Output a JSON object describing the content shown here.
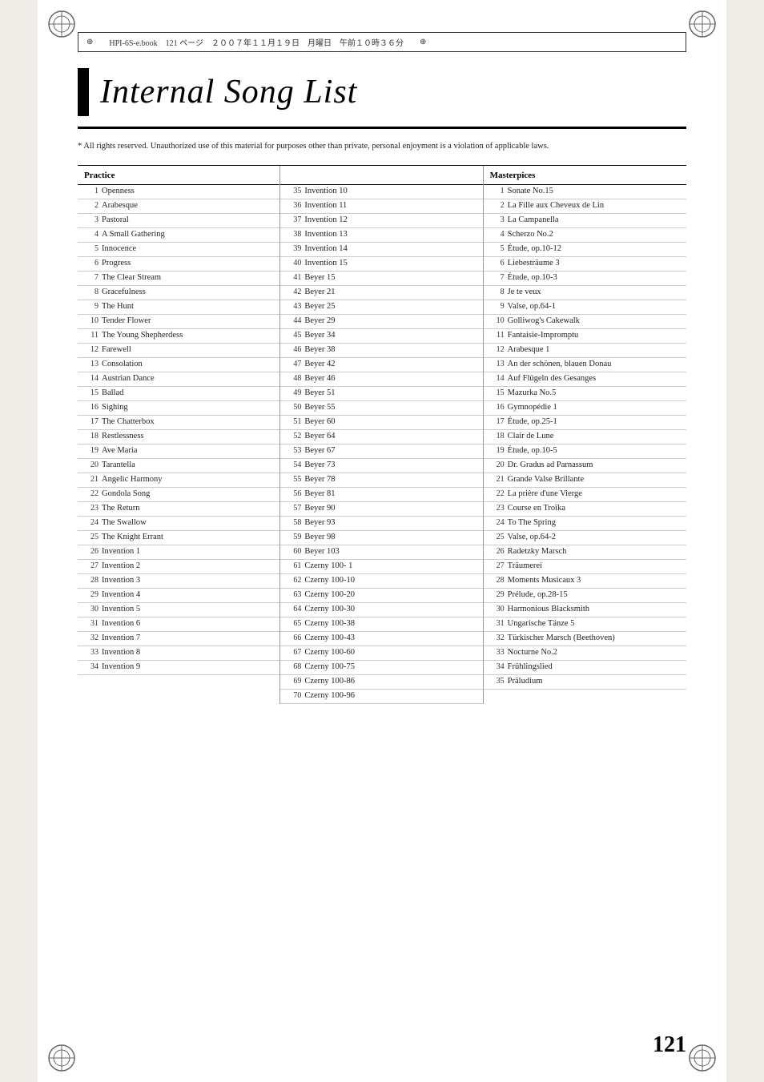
{
  "page": {
    "title": "Internal Song List",
    "page_number": "121",
    "header_text": "HPI-6S-e.book　121 ページ　２００７年１１月１９日　月曜日　午前１０時３６分",
    "copyright": "*   All rights reserved. Unauthorized use of this material for purposes other than private, personal enjoyment is a violation of applicable laws."
  },
  "columns": [
    {
      "header": "Practice",
      "songs": [
        {
          "num": "1",
          "name": "Openness"
        },
        {
          "num": "2",
          "name": "Arabesque"
        },
        {
          "num": "3",
          "name": "Pastoral"
        },
        {
          "num": "4",
          "name": "A Small Gathering"
        },
        {
          "num": "5",
          "name": "Innocence"
        },
        {
          "num": "6",
          "name": "Progress"
        },
        {
          "num": "7",
          "name": "The Clear Stream"
        },
        {
          "num": "8",
          "name": "Gracefulness"
        },
        {
          "num": "9",
          "name": "The Hunt"
        },
        {
          "num": "10",
          "name": "Tender Flower"
        },
        {
          "num": "11",
          "name": "The Young Shepherdess"
        },
        {
          "num": "12",
          "name": "Farewell"
        },
        {
          "num": "13",
          "name": "Consolation"
        },
        {
          "num": "14",
          "name": "Austrian Dance"
        },
        {
          "num": "15",
          "name": "Ballad"
        },
        {
          "num": "16",
          "name": "Sighing"
        },
        {
          "num": "17",
          "name": "The Chatterbox"
        },
        {
          "num": "18",
          "name": "Restlessness"
        },
        {
          "num": "19",
          "name": "Ave Maria"
        },
        {
          "num": "20",
          "name": "Tarantella"
        },
        {
          "num": "21",
          "name": "Angelic Harmony"
        },
        {
          "num": "22",
          "name": "Gondola Song"
        },
        {
          "num": "23",
          "name": "The Return"
        },
        {
          "num": "24",
          "name": "The Swallow"
        },
        {
          "num": "25",
          "name": "The Knight Errant"
        },
        {
          "num": "26",
          "name": "Invention 1"
        },
        {
          "num": "27",
          "name": "Invention 2"
        },
        {
          "num": "28",
          "name": "Invention 3"
        },
        {
          "num": "29",
          "name": "Invention 4"
        },
        {
          "num": "30",
          "name": "Invention 5"
        },
        {
          "num": "31",
          "name": "Invention 6"
        },
        {
          "num": "32",
          "name": "Invention 7"
        },
        {
          "num": "33",
          "name": "Invention 8"
        },
        {
          "num": "34",
          "name": "Invention 9"
        }
      ]
    },
    {
      "header": "",
      "songs": [
        {
          "num": "35",
          "name": "Invention 10"
        },
        {
          "num": "36",
          "name": "Invention 11"
        },
        {
          "num": "37",
          "name": "Invention 12"
        },
        {
          "num": "38",
          "name": "Invention 13"
        },
        {
          "num": "39",
          "name": "Invention 14"
        },
        {
          "num": "40",
          "name": "Invention 15"
        },
        {
          "num": "41",
          "name": "Beyer 15"
        },
        {
          "num": "42",
          "name": "Beyer 21"
        },
        {
          "num": "43",
          "name": "Beyer 25"
        },
        {
          "num": "44",
          "name": "Beyer 29"
        },
        {
          "num": "45",
          "name": "Beyer 34"
        },
        {
          "num": "46",
          "name": "Beyer 38"
        },
        {
          "num": "47",
          "name": "Beyer 42"
        },
        {
          "num": "48",
          "name": "Beyer 46"
        },
        {
          "num": "49",
          "name": "Beyer 51"
        },
        {
          "num": "50",
          "name": "Beyer 55"
        },
        {
          "num": "51",
          "name": "Beyer 60"
        },
        {
          "num": "52",
          "name": "Beyer 64"
        },
        {
          "num": "53",
          "name": "Beyer 67"
        },
        {
          "num": "54",
          "name": "Beyer 73"
        },
        {
          "num": "55",
          "name": "Beyer 78"
        },
        {
          "num": "56",
          "name": "Beyer 81"
        },
        {
          "num": "57",
          "name": "Beyer 90"
        },
        {
          "num": "58",
          "name": "Beyer 93"
        },
        {
          "num": "59",
          "name": "Beyer 98"
        },
        {
          "num": "60",
          "name": "Beyer 103"
        },
        {
          "num": "61",
          "name": "Czerny 100- 1"
        },
        {
          "num": "62",
          "name": "Czerny 100-10"
        },
        {
          "num": "63",
          "name": "Czerny 100-20"
        },
        {
          "num": "64",
          "name": "Czerny 100-30"
        },
        {
          "num": "65",
          "name": "Czerny 100-38"
        },
        {
          "num": "66",
          "name": "Czerny 100-43"
        },
        {
          "num": "67",
          "name": "Czerny 100-60"
        },
        {
          "num": "68",
          "name": "Czerny 100-75"
        },
        {
          "num": "69",
          "name": "Czerny 100-86"
        },
        {
          "num": "70",
          "name": "Czerny 100-96"
        }
      ]
    },
    {
      "header": "Masterpices",
      "songs": [
        {
          "num": "1",
          "name": "Sonate No.15"
        },
        {
          "num": "2",
          "name": "La Fille aux Cheveux de Lin"
        },
        {
          "num": "3",
          "name": "La Campanella"
        },
        {
          "num": "4",
          "name": "Scherzo No.2"
        },
        {
          "num": "5",
          "name": "Étude, op.10-12"
        },
        {
          "num": "6",
          "name": "Liebesträume 3"
        },
        {
          "num": "7",
          "name": "Étude, op.10-3"
        },
        {
          "num": "8",
          "name": "Je te veux"
        },
        {
          "num": "9",
          "name": "Valse, op.64-1"
        },
        {
          "num": "10",
          "name": "Golliwog's Cakewalk"
        },
        {
          "num": "11",
          "name": "Fantaisie-Impromptu"
        },
        {
          "num": "12",
          "name": "Arabesque 1"
        },
        {
          "num": "13",
          "name": "An der schönen, blauen Donau"
        },
        {
          "num": "14",
          "name": "Auf Flügeln des Gesanges"
        },
        {
          "num": "15",
          "name": "Mazurka No.5"
        },
        {
          "num": "16",
          "name": "Gymnopédie 1"
        },
        {
          "num": "17",
          "name": "Étude, op.25-1"
        },
        {
          "num": "18",
          "name": "Clair de Lune"
        },
        {
          "num": "19",
          "name": "Étude, op.10-5"
        },
        {
          "num": "20",
          "name": "Dr. Gradus ad Parnassum"
        },
        {
          "num": "21",
          "name": "Grande Valse Brillante"
        },
        {
          "num": "22",
          "name": "La prière d'une Vierge"
        },
        {
          "num": "23",
          "name": "Course en Troïka"
        },
        {
          "num": "24",
          "name": "To The Spring"
        },
        {
          "num": "25",
          "name": "Valse, op.64-2"
        },
        {
          "num": "26",
          "name": "Radetzky Marsch"
        },
        {
          "num": "27",
          "name": "Träumerei"
        },
        {
          "num": "28",
          "name": "Moments Musicaux 3"
        },
        {
          "num": "29",
          "name": "Prélude, op.28-15"
        },
        {
          "num": "30",
          "name": "Harmonious Blacksmith"
        },
        {
          "num": "31",
          "name": "Ungarische Tänze 5"
        },
        {
          "num": "32",
          "name": "Türkischer Marsch (Beethoven)"
        },
        {
          "num": "33",
          "name": "Nocturne No.2"
        },
        {
          "num": "34",
          "name": "Frühlingslied"
        },
        {
          "num": "35",
          "name": "Präludium"
        }
      ]
    }
  ]
}
